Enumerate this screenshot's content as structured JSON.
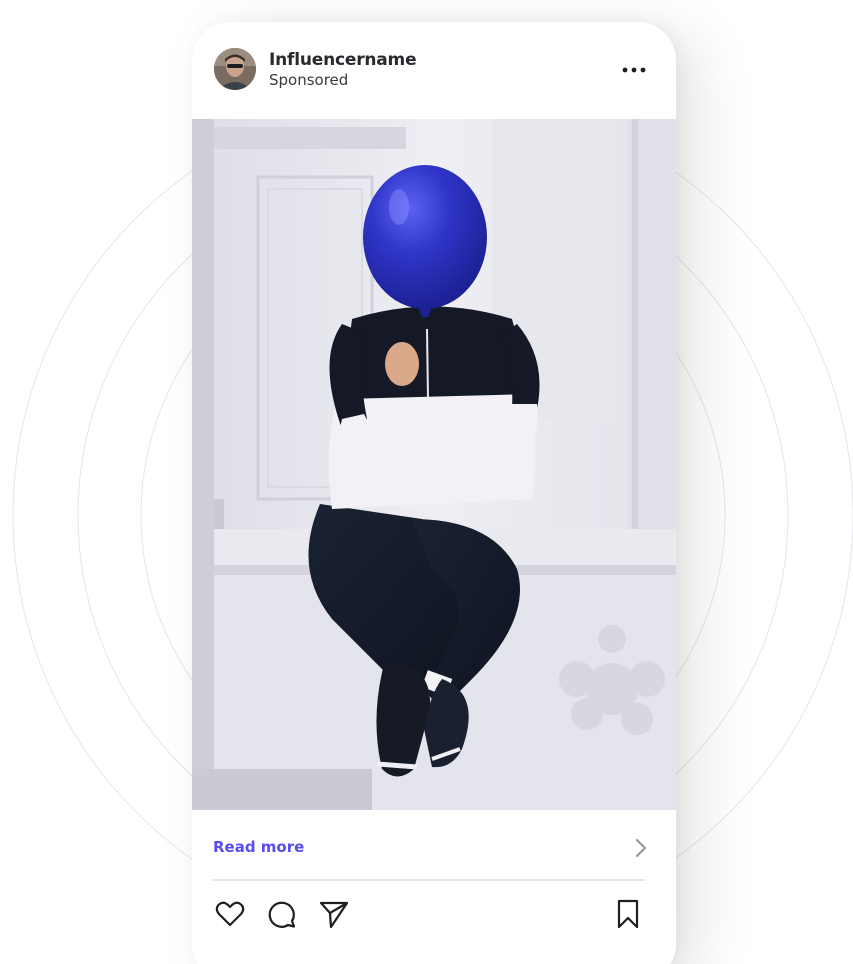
{
  "post": {
    "username": "Influencername",
    "subtitle": "Sponsored",
    "cta_label": "Read more"
  },
  "icons": {
    "more": "more-horizontal-icon",
    "cta_chevron": "chevron-right-icon",
    "like": "heart-icon",
    "comment": "comment-icon",
    "share": "send-icon",
    "save": "bookmark-icon"
  },
  "colors": {
    "cta": "#5a4cf0",
    "text": "#2a2a2e",
    "balloon": "#2f35c9",
    "divider": "#e4e4ec"
  }
}
